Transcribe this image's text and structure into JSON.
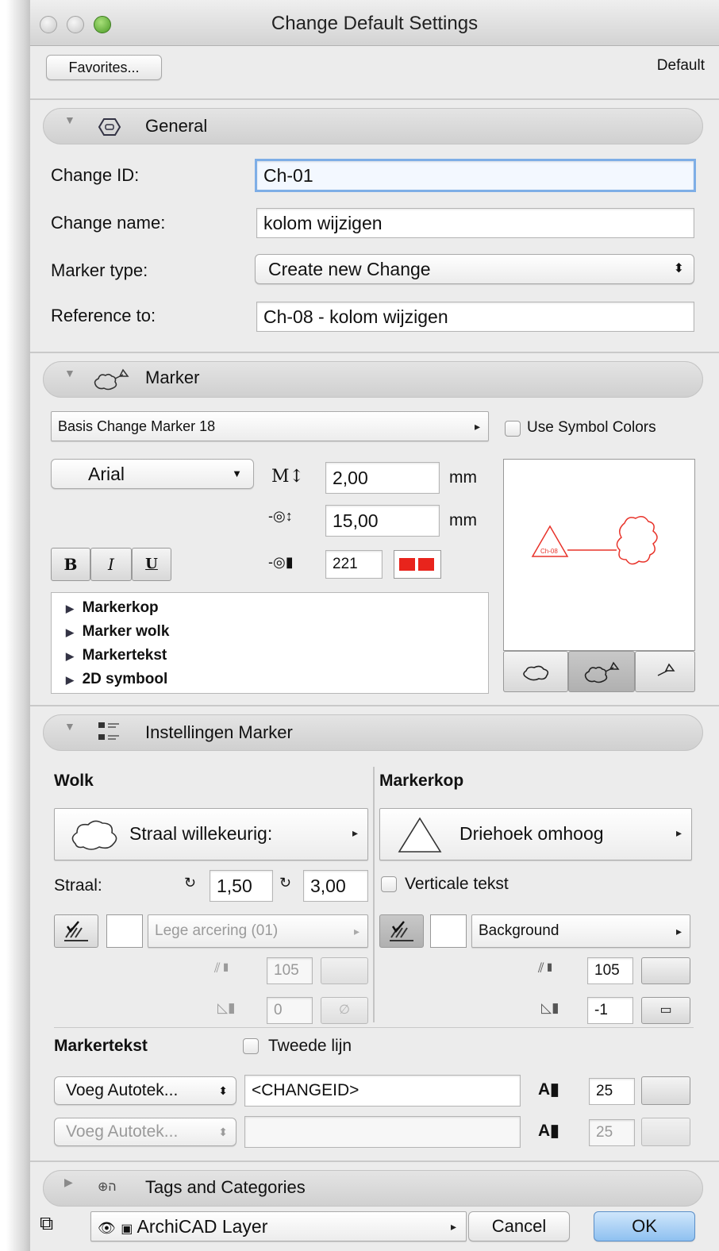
{
  "window": {
    "title": "Change Default Settings"
  },
  "top": {
    "favorites_label": "Favorites...",
    "default_label": "Default"
  },
  "general": {
    "header": "General",
    "change_id_label": "Change ID:",
    "change_id_value": "Ch-01",
    "change_name_label": "Change name:",
    "change_name_value": "kolom wijzigen",
    "marker_type_label": "Marker type:",
    "marker_type_value": "Create new Change",
    "reference_label": "Reference to:",
    "reference_value": "Ch-08 - kolom wijzigen"
  },
  "marker": {
    "header": "Marker",
    "library_part": "Basis Change Marker 18",
    "use_symbol_colors": "Use Symbol Colors",
    "font": "Arial",
    "size1": "2,00",
    "size2": "15,00",
    "unit": "mm",
    "pen": "221",
    "bold": "B",
    "italic": "I",
    "underline": "U",
    "tree": [
      "Markerkop",
      "Marker wolk",
      "Markertekst",
      "2D symbool"
    ],
    "preview_text": "Ch-08",
    "preview_color": "#e8332a"
  },
  "instellingen": {
    "header": "Instellingen Marker",
    "wolk": {
      "title": "Wolk",
      "shape": "Straal willekeurig:",
      "straal_label": "Straal:",
      "straal1": "1,50",
      "straal2": "3,00",
      "fill": "Lege arcering (01)",
      "pen_a": "105",
      "pen_b": "0"
    },
    "markerkop": {
      "title": "Markerkop",
      "shape": "Driehoek omhoog",
      "vertical": "Verticale tekst",
      "fill": "Background",
      "pen_a": "105",
      "pen_b": "-1"
    },
    "markertekst": {
      "title": "Markertekst",
      "tweede_lijn": "Tweede lijn",
      "autotext1": "Voeg Autotek...",
      "field1": "<CHANGEID>",
      "pen1": "25",
      "autotext2": "Voeg Autotek...",
      "field2": "",
      "pen2": "25"
    }
  },
  "tags": {
    "header": "Tags and Categories"
  },
  "bottom": {
    "layer": "ArchiCAD Layer",
    "cancel": "Cancel",
    "ok": "OK"
  },
  "colors": {
    "accent": "#7eaee6",
    "marker_red": "#e8332a",
    "ok_blue": "#8ec0f0"
  }
}
